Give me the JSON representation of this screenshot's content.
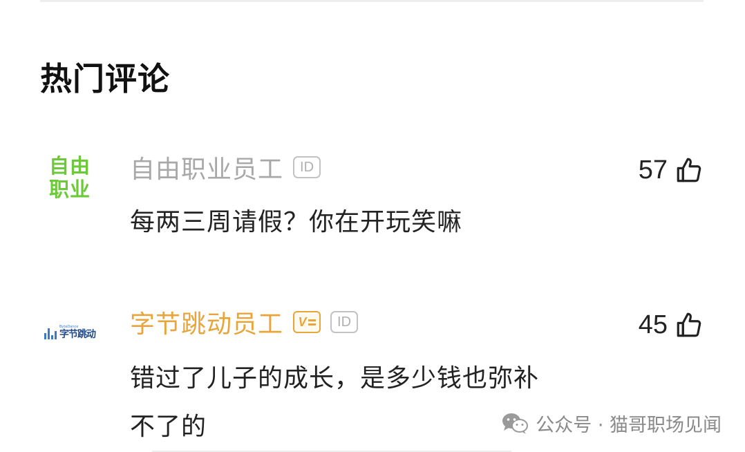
{
  "section": {
    "title": "热门评论"
  },
  "comments": [
    {
      "avatar_lines": [
        "自由",
        "职业"
      ],
      "user": "自由职业员工",
      "id_badge": "ID",
      "lines": [
        "每两三周请假？你在开玩笑嘛"
      ],
      "likes": "57",
      "name_color": "#a8a8a8"
    },
    {
      "avatar_logo": {
        "en": "ByteDance",
        "cn": "字节跳动"
      },
      "user": "字节跳动员工",
      "verified_badge": "V",
      "id_badge": "ID",
      "lines": [
        "错过了儿子的成长，是多少钱也弥补",
        "不了的"
      ],
      "likes": "45",
      "name_color": "#e7a53a"
    }
  ],
  "watermark": {
    "text": "公众号 · 猫哥职场见闻",
    "icon": "wechat-icon"
  },
  "colors": {
    "avatar_green": "#6cc93a",
    "bytedance_blue": "#3c78c8",
    "verified_gold": "#e7a53a"
  }
}
